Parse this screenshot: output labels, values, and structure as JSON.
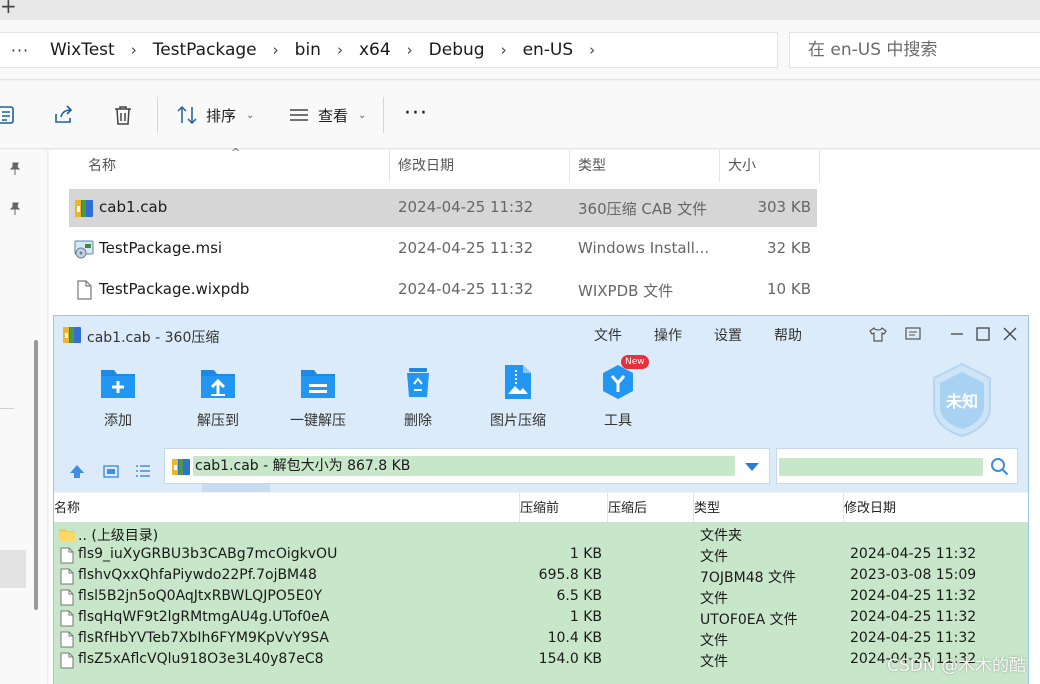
{
  "address": {
    "more": "···",
    "crumbs": [
      "WixTest",
      "TestPackage",
      "bin",
      "x64",
      "Debug",
      "en-US"
    ],
    "separator": "›",
    "search_placeholder": "在 en-US 中搜索"
  },
  "toolbar": {
    "sort_label": "排序",
    "view_label": "查看",
    "more": "···"
  },
  "explorer_columns": {
    "name": "名称",
    "date": "修改日期",
    "type": "类型",
    "size": "大小"
  },
  "explorer_files": [
    {
      "name": "cab1.cab",
      "date": "2024-04-25 11:32",
      "type": "360压缩 CAB 文件",
      "size": "303 KB",
      "icon": "cab-archive-icon",
      "selected": true
    },
    {
      "name": "TestPackage.msi",
      "date": "2024-04-25 11:32",
      "type": "Windows Install...",
      "size": "32 KB",
      "icon": "msi-installer-icon",
      "selected": false
    },
    {
      "name": "TestPackage.wixpdb",
      "date": "2024-04-25 11:32",
      "type": "WIXPDB 文件",
      "size": "10 KB",
      "icon": "document-icon",
      "selected": false
    }
  ],
  "zip": {
    "title": "cab1.cab - 360压缩",
    "menu": [
      "文件",
      "操作",
      "设置",
      "帮助"
    ],
    "ribbon": [
      {
        "label": "添加",
        "icon": "add-icon"
      },
      {
        "label": "解压到",
        "icon": "extract-to-icon"
      },
      {
        "label": "一键解压",
        "icon": "quick-extract-icon"
      },
      {
        "label": "删除",
        "icon": "delete-icon"
      },
      {
        "label": "图片压缩",
        "icon": "image-compress-icon"
      },
      {
        "label": "工具",
        "icon": "tools-icon"
      }
    ],
    "new_badge": "New",
    "status_badge": "未知",
    "path_text": "cab1.cab - 解包大小为 867.8 KB",
    "columns": {
      "name": "名称",
      "before": "压缩前",
      "after": "压缩后",
      "type": "类型",
      "date": "修改日期"
    },
    "rows": [
      {
        "name": ".. (上级目录)",
        "size": "",
        "type": "文件夹",
        "date": "",
        "icon": "folder-icon"
      },
      {
        "name": "fls9_iuXyGRBU3b3CABg7mcOigkvOU",
        "size": "1 KB",
        "type": "文件",
        "date": "2024-04-25 11:32",
        "icon": "file-icon"
      },
      {
        "name": "flshvQxxQhfaPiywdo22Pf.7ojBM48",
        "size": "695.8 KB",
        "type": "7OJBM48 文件",
        "date": "2023-03-08 15:09",
        "icon": "file-icon"
      },
      {
        "name": "flsl5B2jn5oQ0AqJtxRBWLQJPO5E0Y",
        "size": "6.5 KB",
        "type": "文件",
        "date": "2024-04-25 11:32",
        "icon": "file-icon"
      },
      {
        "name": "flsqHqWF9t2lgRMtmgAU4g.UTof0eA",
        "size": "1 KB",
        "type": "UTOF0EA 文件",
        "date": "2024-04-25 11:32",
        "icon": "file-icon"
      },
      {
        "name": "flsRfHbYVTeb7XbIh6FYM9KpVvY9SA",
        "size": "10.4 KB",
        "type": "文件",
        "date": "2024-04-25 11:32",
        "icon": "file-icon"
      },
      {
        "name": "flsZ5xAflcVQlu918O3e3L40y87eC8",
        "size": "154.0 KB",
        "type": "文件",
        "date": "2024-04-25 11:32",
        "icon": "file-icon"
      }
    ]
  },
  "watermark": "CSDN @木木的酷"
}
